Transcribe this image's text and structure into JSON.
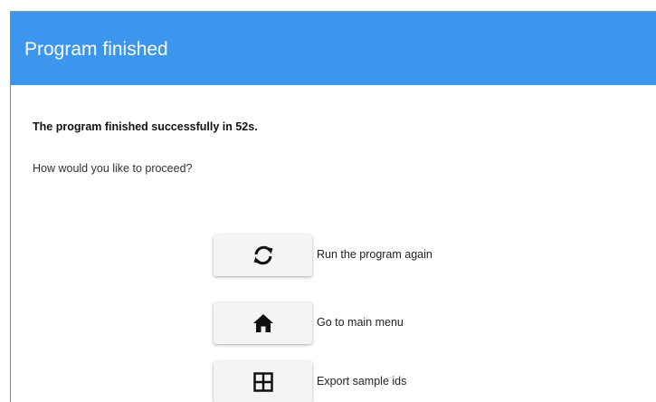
{
  "dialog": {
    "title": "Program finished",
    "message": "The program finished successfully in 52s.",
    "question": "How would you like to proceed?",
    "header_color": "#3c96ee"
  },
  "actions": [
    {
      "icon": "refresh-icon",
      "label": "Run the program again"
    },
    {
      "icon": "home-icon",
      "label": "Go to main menu"
    },
    {
      "icon": "grid-icon",
      "label": "Export sample ids"
    }
  ]
}
